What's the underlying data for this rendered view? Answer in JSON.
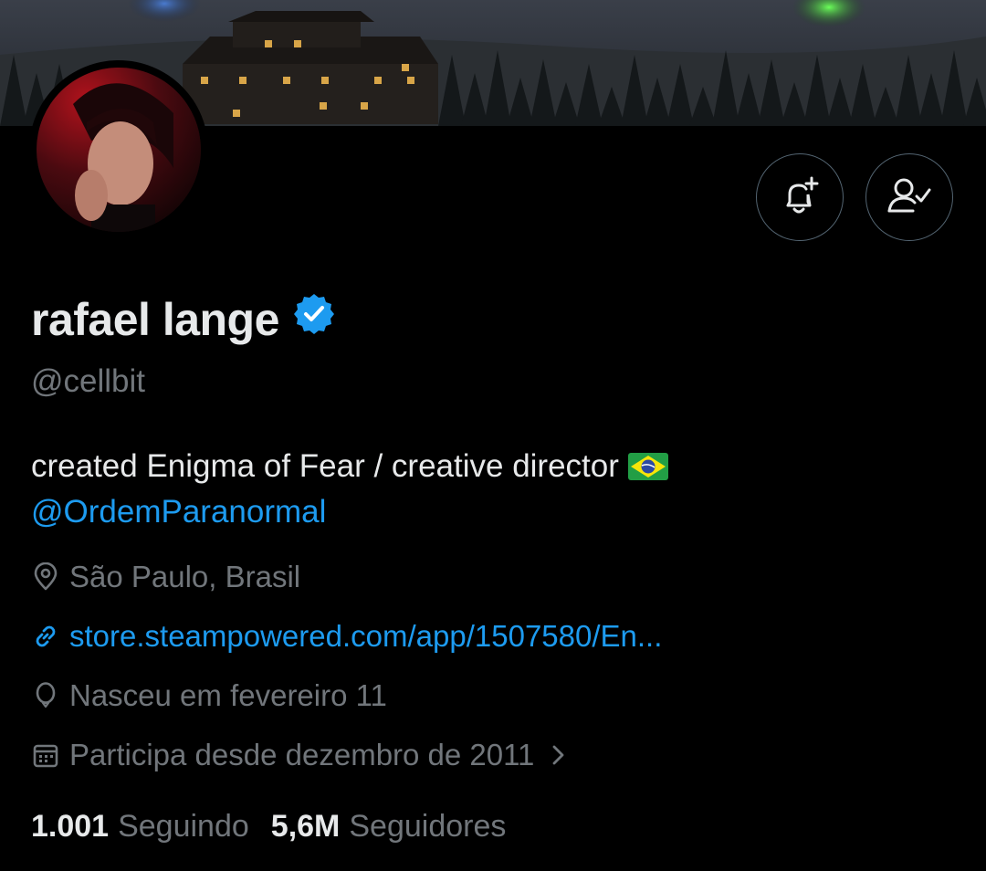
{
  "profile": {
    "name": "rafael lange",
    "handle": "@cellbit",
    "bio_text": "created Enigma of Fear / creative director",
    "bio_mention": "@OrdemParanormal",
    "location": "São Paulo, Brasil",
    "website": "store.steampowered.com/app/1507580/En...",
    "birthday": "Nasceu em fevereiro 11",
    "joined": "Participa desde dezembro de 2011"
  },
  "stats": {
    "following_count": "1.001",
    "following_label": "Seguindo",
    "followers_count": "5,6M",
    "followers_label": "Seguidores"
  },
  "colors": {
    "background": "#000000",
    "text_primary": "#e7e9ea",
    "text_secondary": "#71767b",
    "accent": "#1d9bf0",
    "border": "#536471"
  },
  "icons": [
    "notification-bell-plus-icon",
    "following-user-check-icon",
    "verified-badge-icon",
    "location-pin-icon",
    "link-icon",
    "balloon-icon",
    "calendar-icon",
    "chevron-right-icon",
    "brazil-flag-icon"
  ]
}
